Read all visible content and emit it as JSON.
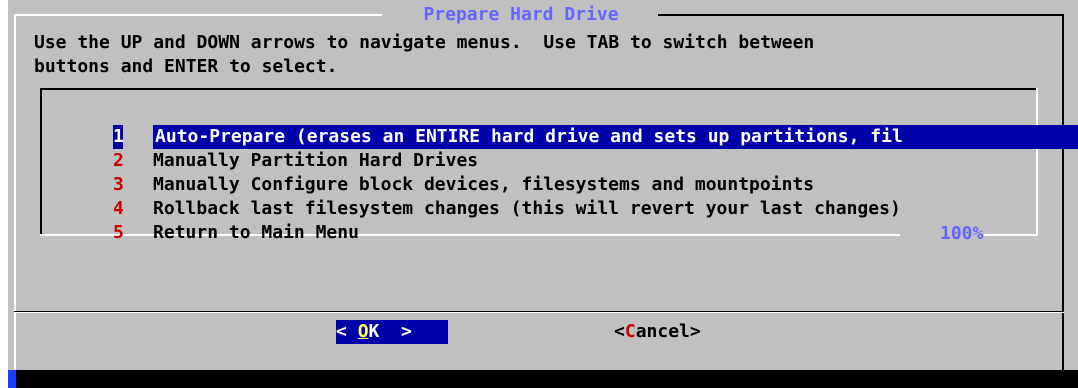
{
  "dialog": {
    "title": " Prepare Hard Drive ",
    "instructions": "Use the UP and DOWN arrows to navigate menus.  Use TAB to switch between\nbuttons and ENTER to select.",
    "scroll_percent": "100%"
  },
  "menu": {
    "selected_index": 0,
    "items": [
      {
        "num": "1",
        "label": "Auto-Prepare (erases an ENTIRE hard drive and sets up partitions, fil"
      },
      {
        "num": "2",
        "label": "Manually Partition Hard Drives"
      },
      {
        "num": "3",
        "label": "Manually Configure block devices, filesystems and mountpoints"
      },
      {
        "num": "4",
        "label": "Rollback last filesystem changes (this will revert your last changes)"
      },
      {
        "num": "5",
        "label": "Return to Main Menu"
      }
    ]
  },
  "buttons": {
    "ok": {
      "left": "< ",
      "hotkey": "O",
      "rest": "K",
      "right": "  >"
    },
    "cancel": {
      "left": "<",
      "hotkey": "C",
      "rest": "ancel",
      "right": ">"
    }
  },
  "colors": {
    "background": "#c0c0c0",
    "title": "#6464ff",
    "selection": "#0000aa",
    "hotkey": "#c80000"
  }
}
